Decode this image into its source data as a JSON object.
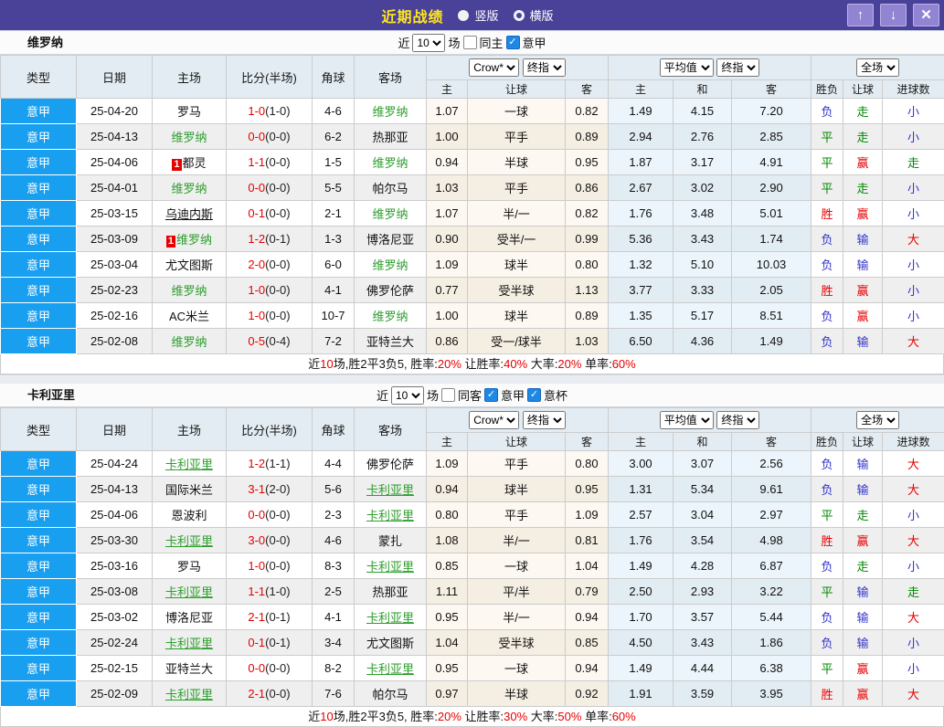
{
  "titlebar": {
    "title": "近期战绩",
    "vertical_label": "竖版",
    "horizontal_label": "横版",
    "up_icon": "↑",
    "down_icon": "↓",
    "close_icon": "✕"
  },
  "colors": {
    "titlebar_purple": "#4a4199",
    "league_blue": "#189ff0",
    "team_green": "#2e9e2e",
    "score_red": "#e60000"
  },
  "result_colors": {
    "胜": "#e60000",
    "赢": "#e60000",
    "大": "#e60000",
    "平": "#008800",
    "走": "#008800",
    "负": "#3333cc",
    "输": "#3333cc",
    "小": "#3333cc"
  },
  "columns": {
    "left": [
      "类型",
      "日期",
      "主场",
      "比分(半场)",
      "角球",
      "客场"
    ],
    "group1_cols": [
      "主",
      "让球",
      "客"
    ],
    "group2_cols": [
      "主",
      "和",
      "客"
    ],
    "group3_cols": [
      "胜负",
      "让球",
      "进球数"
    ]
  },
  "selects": {
    "company": "Crow*",
    "final1": "终指",
    "average": "平均值",
    "final2": "终指",
    "fulltime": "全场"
  },
  "tables": [
    {
      "team": "维罗纳",
      "controls": {
        "prefix": "近",
        "count": "10",
        "suffix": "场",
        "checks": [
          {
            "label": "同主",
            "checked": false
          },
          {
            "label": "意甲",
            "checked": true
          }
        ]
      },
      "rows": [
        {
          "league": "意甲",
          "date": "25-04-20",
          "home": "罗马",
          "home_green": false,
          "home_underline": false,
          "home_badge": "",
          "score": "1-0",
          "half": "(1-0)",
          "corner": "4-6",
          "away": "维罗纳",
          "away_green": true,
          "away_underline": false,
          "o_home": "1.07",
          "handicap": "一球",
          "o_away": "0.82",
          "avg_home": "1.49",
          "avg_draw": "4.15",
          "avg_away": "7.20",
          "res_wdl": "负",
          "res_handicap": "走",
          "res_goals": "小"
        },
        {
          "league": "意甲",
          "date": "25-04-13",
          "home": "维罗纳",
          "home_green": true,
          "home_underline": false,
          "home_badge": "",
          "score": "0-0",
          "half": "(0-0)",
          "corner": "6-2",
          "away": "热那亚",
          "away_green": false,
          "away_underline": false,
          "o_home": "1.00",
          "handicap": "平手",
          "o_away": "0.89",
          "avg_home": "2.94",
          "avg_draw": "2.76",
          "avg_away": "2.85",
          "res_wdl": "平",
          "res_handicap": "走",
          "res_goals": "小"
        },
        {
          "league": "意甲",
          "date": "25-04-06",
          "home": "都灵",
          "home_green": false,
          "home_underline": false,
          "home_badge": "1",
          "score": "1-1",
          "half": "(0-0)",
          "corner": "1-5",
          "away": "维罗纳",
          "away_green": true,
          "away_underline": false,
          "o_home": "0.94",
          "handicap": "半球",
          "o_away": "0.95",
          "avg_home": "1.87",
          "avg_draw": "3.17",
          "avg_away": "4.91",
          "res_wdl": "平",
          "res_handicap": "赢",
          "res_goals": "走"
        },
        {
          "league": "意甲",
          "date": "25-04-01",
          "home": "维罗纳",
          "home_green": true,
          "home_underline": false,
          "home_badge": "",
          "score": "0-0",
          "half": "(0-0)",
          "corner": "5-5",
          "away": "帕尔马",
          "away_green": false,
          "away_underline": false,
          "o_home": "1.03",
          "handicap": "平手",
          "o_away": "0.86",
          "avg_home": "2.67",
          "avg_draw": "3.02",
          "avg_away": "2.90",
          "res_wdl": "平",
          "res_handicap": "走",
          "res_goals": "小"
        },
        {
          "league": "意甲",
          "date": "25-03-15",
          "home": "乌迪内斯",
          "home_green": false,
          "home_underline": true,
          "home_badge": "",
          "score": "0-1",
          "half": "(0-0)",
          "corner": "2-1",
          "away": "维罗纳",
          "away_green": true,
          "away_underline": false,
          "o_home": "1.07",
          "handicap": "半/一",
          "o_away": "0.82",
          "avg_home": "1.76",
          "avg_draw": "3.48",
          "avg_away": "5.01",
          "res_wdl": "胜",
          "res_handicap": "赢",
          "res_goals": "小"
        },
        {
          "league": "意甲",
          "date": "25-03-09",
          "home": "维罗纳",
          "home_green": true,
          "home_underline": false,
          "home_badge": "1",
          "score": "1-2",
          "half": "(0-1)",
          "corner": "1-3",
          "away": "博洛尼亚",
          "away_green": false,
          "away_underline": false,
          "o_home": "0.90",
          "handicap": "受半/一",
          "o_away": "0.99",
          "avg_home": "5.36",
          "avg_draw": "3.43",
          "avg_away": "1.74",
          "res_wdl": "负",
          "res_handicap": "输",
          "res_goals": "大"
        },
        {
          "league": "意甲",
          "date": "25-03-04",
          "home": "尤文图斯",
          "home_green": false,
          "home_underline": false,
          "home_badge": "",
          "score": "2-0",
          "half": "(0-0)",
          "corner": "6-0",
          "away": "维罗纳",
          "away_green": true,
          "away_underline": false,
          "o_home": "1.09",
          "handicap": "球半",
          "o_away": "0.80",
          "avg_home": "1.32",
          "avg_draw": "5.10",
          "avg_away": "10.03",
          "res_wdl": "负",
          "res_handicap": "输",
          "res_goals": "小"
        },
        {
          "league": "意甲",
          "date": "25-02-23",
          "home": "维罗纳",
          "home_green": true,
          "home_underline": false,
          "home_badge": "",
          "score": "1-0",
          "half": "(0-0)",
          "corner": "4-1",
          "away": "佛罗伦萨",
          "away_green": false,
          "away_underline": false,
          "o_home": "0.77",
          "handicap": "受半球",
          "o_away": "1.13",
          "avg_home": "3.77",
          "avg_draw": "3.33",
          "avg_away": "2.05",
          "res_wdl": "胜",
          "res_handicap": "赢",
          "res_goals": "小"
        },
        {
          "league": "意甲",
          "date": "25-02-16",
          "home": "AC米兰",
          "home_green": false,
          "home_underline": false,
          "home_badge": "",
          "score": "1-0",
          "half": "(0-0)",
          "corner": "10-7",
          "away": "维罗纳",
          "away_green": true,
          "away_underline": false,
          "o_home": "1.00",
          "handicap": "球半",
          "o_away": "0.89",
          "avg_home": "1.35",
          "avg_draw": "5.17",
          "avg_away": "8.51",
          "res_wdl": "负",
          "res_handicap": "赢",
          "res_goals": "小"
        },
        {
          "league": "意甲",
          "date": "25-02-08",
          "home": "维罗纳",
          "home_green": true,
          "home_underline": false,
          "home_badge": "",
          "score": "0-5",
          "half": "(0-4)",
          "corner": "7-2",
          "away": "亚特兰大",
          "away_green": false,
          "away_underline": false,
          "o_home": "0.86",
          "handicap": "受一/球半",
          "o_away": "1.03",
          "avg_home": "6.50",
          "avg_draw": "4.36",
          "avg_away": "1.49",
          "res_wdl": "负",
          "res_handicap": "输",
          "res_goals": "大"
        }
      ],
      "summary": [
        {
          "t": "近"
        },
        {
          "t": "10",
          "red": true
        },
        {
          "t": "场,胜2平3负5, 胜率:"
        },
        {
          "t": "20%",
          "red": true
        },
        {
          "t": " 让胜率:"
        },
        {
          "t": "40%",
          "red": true
        },
        {
          "t": " 大率:"
        },
        {
          "t": "20%",
          "red": true
        },
        {
          "t": " 单率:"
        },
        {
          "t": "60%",
          "red": true
        }
      ]
    },
    {
      "team": "卡利亚里",
      "controls": {
        "prefix": "近",
        "count": "10",
        "suffix": "场",
        "checks": [
          {
            "label": "同客",
            "checked": false
          },
          {
            "label": "意甲",
            "checked": true
          },
          {
            "label": "意杯",
            "checked": true
          }
        ]
      },
      "rows": [
        {
          "league": "意甲",
          "date": "25-04-24",
          "home": "卡利亚里",
          "home_green": true,
          "home_underline": true,
          "home_badge": "",
          "score": "1-2",
          "half": "(1-1)",
          "corner": "4-4",
          "away": "佛罗伦萨",
          "away_green": false,
          "away_underline": false,
          "o_home": "1.09",
          "handicap": "平手",
          "o_away": "0.80",
          "avg_home": "3.00",
          "avg_draw": "3.07",
          "avg_away": "2.56",
          "res_wdl": "负",
          "res_handicap": "输",
          "res_goals": "大"
        },
        {
          "league": "意甲",
          "date": "25-04-13",
          "home": "国际米兰",
          "home_green": false,
          "home_underline": false,
          "home_badge": "",
          "score": "3-1",
          "half": "(2-0)",
          "corner": "5-6",
          "away": "卡利亚里",
          "away_green": true,
          "away_underline": true,
          "o_home": "0.94",
          "handicap": "球半",
          "o_away": "0.95",
          "avg_home": "1.31",
          "avg_draw": "5.34",
          "avg_away": "9.61",
          "res_wdl": "负",
          "res_handicap": "输",
          "res_goals": "大"
        },
        {
          "league": "意甲",
          "date": "25-04-06",
          "home": "恩波利",
          "home_green": false,
          "home_underline": false,
          "home_badge": "",
          "score": "0-0",
          "half": "(0-0)",
          "corner": "2-3",
          "away": "卡利亚里",
          "away_green": true,
          "away_underline": true,
          "o_home": "0.80",
          "handicap": "平手",
          "o_away": "1.09",
          "avg_home": "2.57",
          "avg_draw": "3.04",
          "avg_away": "2.97",
          "res_wdl": "平",
          "res_handicap": "走",
          "res_goals": "小"
        },
        {
          "league": "意甲",
          "date": "25-03-30",
          "home": "卡利亚里",
          "home_green": true,
          "home_underline": true,
          "home_badge": "",
          "score": "3-0",
          "half": "(0-0)",
          "corner": "4-6",
          "away": "蒙扎",
          "away_green": false,
          "away_underline": false,
          "o_home": "1.08",
          "handicap": "半/一",
          "o_away": "0.81",
          "avg_home": "1.76",
          "avg_draw": "3.54",
          "avg_away": "4.98",
          "res_wdl": "胜",
          "res_handicap": "赢",
          "res_goals": "大"
        },
        {
          "league": "意甲",
          "date": "25-03-16",
          "home": "罗马",
          "home_green": false,
          "home_underline": false,
          "home_badge": "",
          "score": "1-0",
          "half": "(0-0)",
          "corner": "8-3",
          "away": "卡利亚里",
          "away_green": true,
          "away_underline": true,
          "o_home": "0.85",
          "handicap": "一球",
          "o_away": "1.04",
          "avg_home": "1.49",
          "avg_draw": "4.28",
          "avg_away": "6.87",
          "res_wdl": "负",
          "res_handicap": "走",
          "res_goals": "小"
        },
        {
          "league": "意甲",
          "date": "25-03-08",
          "home": "卡利亚里",
          "home_green": true,
          "home_underline": true,
          "home_badge": "",
          "score": "1-1",
          "half": "(1-0)",
          "corner": "2-5",
          "away": "热那亚",
          "away_green": false,
          "away_underline": false,
          "o_home": "1.11",
          "handicap": "平/半",
          "o_away": "0.79",
          "avg_home": "2.50",
          "avg_draw": "2.93",
          "avg_away": "3.22",
          "res_wdl": "平",
          "res_handicap": "输",
          "res_goals": "走"
        },
        {
          "league": "意甲",
          "date": "25-03-02",
          "home": "博洛尼亚",
          "home_green": false,
          "home_underline": false,
          "home_badge": "",
          "score": "2-1",
          "half": "(0-1)",
          "corner": "4-1",
          "away": "卡利亚里",
          "away_green": true,
          "away_underline": true,
          "o_home": "0.95",
          "handicap": "半/一",
          "o_away": "0.94",
          "avg_home": "1.70",
          "avg_draw": "3.57",
          "avg_away": "5.44",
          "res_wdl": "负",
          "res_handicap": "输",
          "res_goals": "大"
        },
        {
          "league": "意甲",
          "date": "25-02-24",
          "home": "卡利亚里",
          "home_green": true,
          "home_underline": true,
          "home_badge": "",
          "score": "0-1",
          "half": "(0-1)",
          "corner": "3-4",
          "away": "尤文图斯",
          "away_green": false,
          "away_underline": false,
          "o_home": "1.04",
          "handicap": "受半球",
          "o_away": "0.85",
          "avg_home": "4.50",
          "avg_draw": "3.43",
          "avg_away": "1.86",
          "res_wdl": "负",
          "res_handicap": "输",
          "res_goals": "小"
        },
        {
          "league": "意甲",
          "date": "25-02-15",
          "home": "亚特兰大",
          "home_green": false,
          "home_underline": false,
          "home_badge": "",
          "score": "0-0",
          "half": "(0-0)",
          "corner": "8-2",
          "away": "卡利亚里",
          "away_green": true,
          "away_underline": true,
          "o_home": "0.95",
          "handicap": "一球",
          "o_away": "0.94",
          "avg_home": "1.49",
          "avg_draw": "4.44",
          "avg_away": "6.38",
          "res_wdl": "平",
          "res_handicap": "赢",
          "res_goals": "小"
        },
        {
          "league": "意甲",
          "date": "25-02-09",
          "home": "卡利亚里",
          "home_green": true,
          "home_underline": true,
          "home_badge": "",
          "score": "2-1",
          "half": "(0-0)",
          "corner": "7-6",
          "away": "帕尔马",
          "away_green": false,
          "away_underline": false,
          "o_home": "0.97",
          "handicap": "半球",
          "o_away": "0.92",
          "avg_home": "1.91",
          "avg_draw": "3.59",
          "avg_away": "3.95",
          "res_wdl": "胜",
          "res_handicap": "赢",
          "res_goals": "大"
        }
      ],
      "summary": [
        {
          "t": "近"
        },
        {
          "t": "10",
          "red": true
        },
        {
          "t": "场,胜2平3负5, 胜率:"
        },
        {
          "t": "20%",
          "red": true
        },
        {
          "t": " 让胜率:"
        },
        {
          "t": "30%",
          "red": true
        },
        {
          "t": " 大率:"
        },
        {
          "t": "50%",
          "red": true
        },
        {
          "t": " 单率:"
        },
        {
          "t": "60%",
          "red": true
        }
      ]
    }
  ]
}
